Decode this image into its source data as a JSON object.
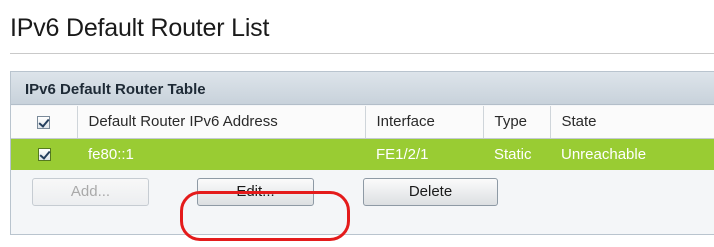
{
  "page": {
    "title": "IPv6 Default Router List"
  },
  "panel": {
    "header": "IPv6 Default Router Table",
    "columns": [
      "Default Router IPv6 Address",
      "Interface",
      "Type",
      "State"
    ],
    "rows": [
      {
        "checked": true,
        "selected": true,
        "address": "fe80::1",
        "interface": "FE1/2/1",
        "type": "Static",
        "state": "Unreachable"
      }
    ]
  },
  "buttons": {
    "add": {
      "label": "Add...",
      "enabled": false
    },
    "edit": {
      "label": "Edit...",
      "enabled": true,
      "highlighted": true
    },
    "delete": {
      "label": "Delete",
      "enabled": true
    }
  },
  "colors": {
    "selected_row": "#99cc33",
    "highlight_ring": "#e41b1b"
  },
  "icons": {
    "checkbox": "checkbox-checked-icon"
  }
}
